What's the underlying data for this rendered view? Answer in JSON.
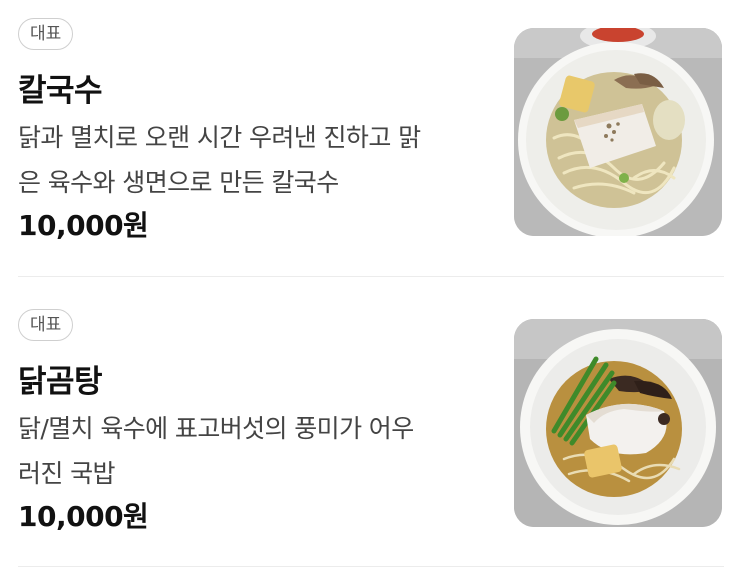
{
  "menu_items": [
    {
      "badge": "대표",
      "name": "칼국수",
      "description_lines": [
        "닭과 멸치로 오랜 시간 우려낸 진하고 맑",
        "은 육수와 생면으로 만든 칼국수"
      ],
      "price": "10,000원"
    },
    {
      "badge": "대표",
      "name": "닭곰탕",
      "description_lines": [
        "닭/멸치 육수에 표고버섯의 풍미가 어우",
        "러진 국밥"
      ],
      "price": "10,000원"
    }
  ]
}
